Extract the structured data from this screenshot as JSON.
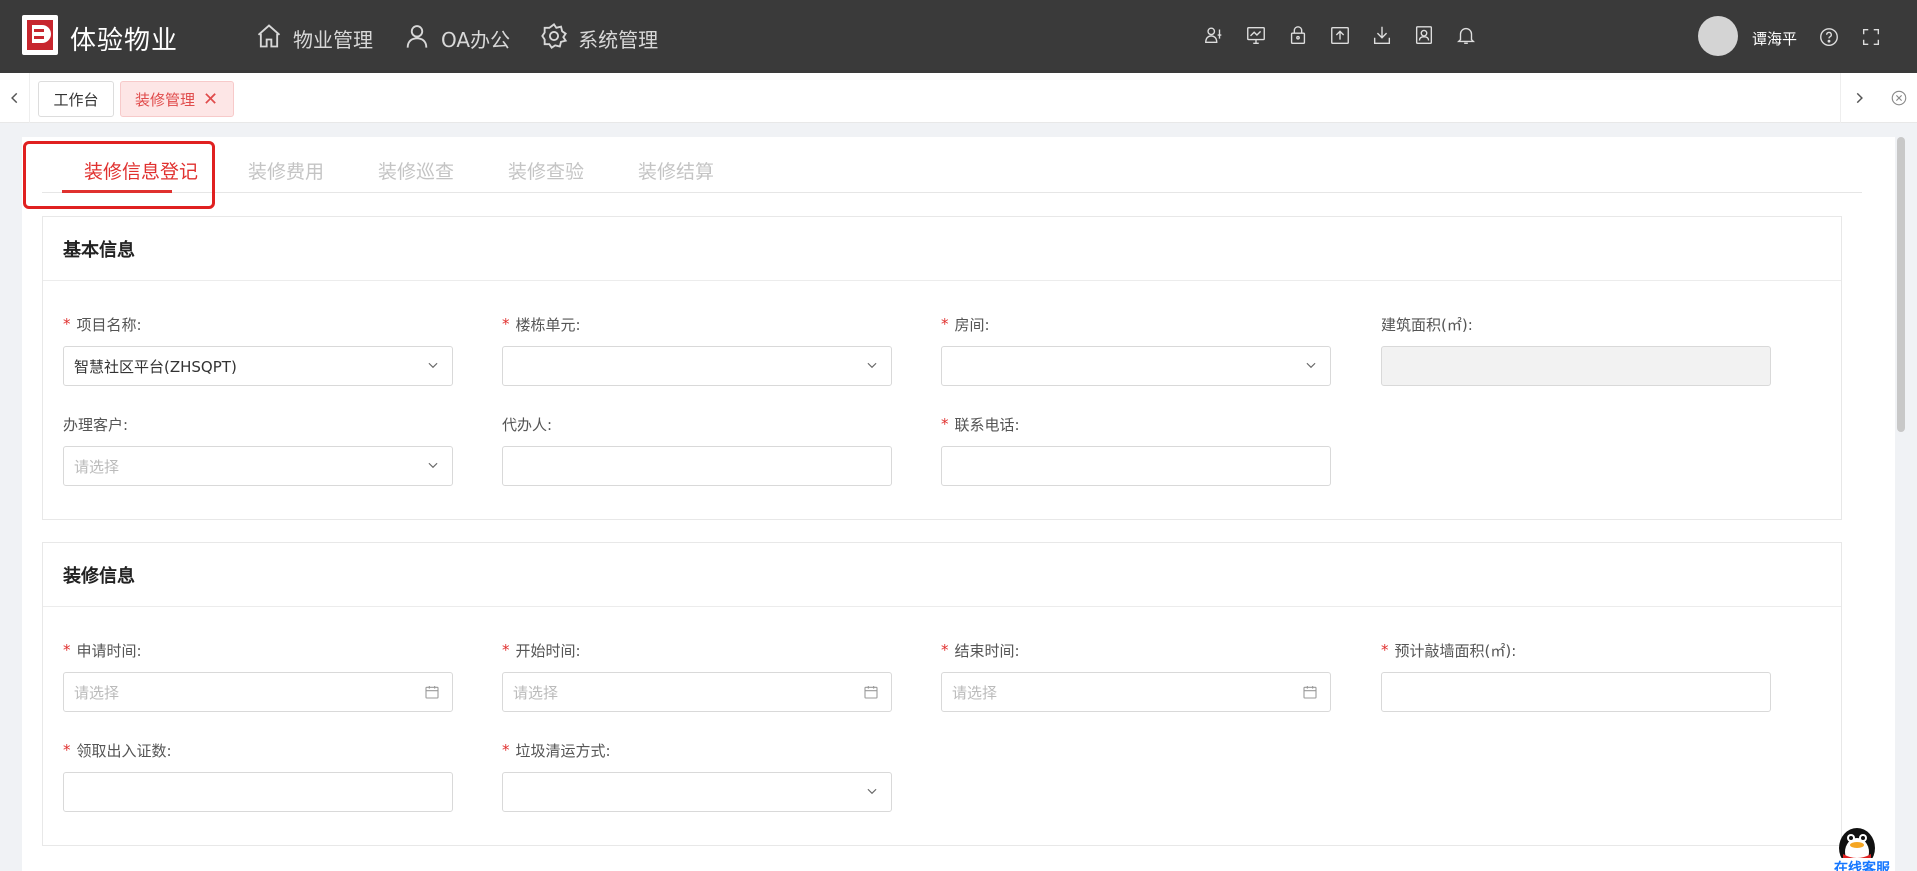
{
  "header": {
    "app_title": "体验物业",
    "nav": [
      {
        "label": "物业管理",
        "icon": "home-icon"
      },
      {
        "label": "OA办公",
        "icon": "user-icon"
      },
      {
        "label": "系统管理",
        "icon": "gear-icon"
      }
    ],
    "tools": [
      "user-settings-icon",
      "monitor-icon",
      "lock-icon",
      "upload-icon",
      "download-icon",
      "contact-card-icon",
      "bell-icon"
    ],
    "username": "谭海平"
  },
  "tabstrip": {
    "tabs": [
      {
        "label": "工作台",
        "active": false
      },
      {
        "label": "装修管理",
        "active": true,
        "close": "✕"
      }
    ]
  },
  "subtabs": [
    "装修信息登记",
    "装修费用",
    "装修巡查",
    "装修查验",
    "装修结算"
  ],
  "basic_info": {
    "title": "基本信息",
    "project_name": {
      "label": "项目名称:",
      "value": "智慧社区平台(ZHSQPT)"
    },
    "building_unit": {
      "label": "楼栋单元:"
    },
    "room": {
      "label": "房间:"
    },
    "building_area": {
      "label": "建筑面积(㎡):"
    },
    "customer": {
      "label": "办理客户:",
      "placeholder": "请选择"
    },
    "agent": {
      "label": "代办人:"
    },
    "phone": {
      "label": "联系电话:"
    }
  },
  "decoration_info": {
    "title": "装修信息",
    "apply_time": {
      "label": "申请时间:",
      "placeholder": "请选择"
    },
    "start_time": {
      "label": "开始时间:",
      "placeholder": "请选择"
    },
    "end_time": {
      "label": "结束时间:",
      "placeholder": "请选择"
    },
    "wall_area": {
      "label": "预计敲墙面积(㎡):"
    },
    "pass_count": {
      "label": "领取出入证数:"
    },
    "garbage_method": {
      "label": "垃圾清运方式:"
    }
  },
  "widget": {
    "label": "在线客服"
  },
  "colors": {
    "accent": "#e0312f",
    "header_bg": "#3a3a3a",
    "active_tab_bg": "#fde6e6"
  }
}
